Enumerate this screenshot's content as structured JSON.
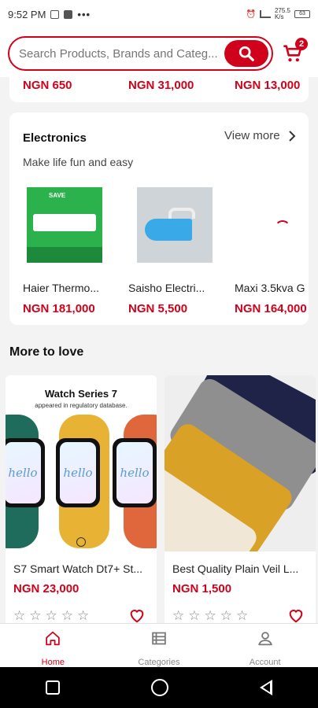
{
  "status_bar": {
    "time": "9:52 PM",
    "dots": "•••",
    "speed": "275.5\nK/s",
    "battery": "63"
  },
  "search": {
    "placeholder": "Search Products, Brands and Categ..."
  },
  "cart": {
    "count": "2"
  },
  "previous_row": {
    "prices": [
      "NGN 650",
      "NGN 31,000",
      "NGN 13,000"
    ]
  },
  "electronics": {
    "title": "Electronics",
    "subtitle": "Make life fun and easy",
    "view_more": "View more",
    "products": [
      {
        "name": "Haier Thermo...",
        "price": "NGN 181,000",
        "image_badge": "SAVE"
      },
      {
        "name": "Saisho Electri...",
        "price": "NGN 5,500"
      },
      {
        "name": "Maxi 3.5kva G",
        "price": "NGN 164,000"
      }
    ]
  },
  "more_to_love": {
    "title": "More to love",
    "items": [
      {
        "headline": "Watch Series 7",
        "note": "appeared in regulatory database.",
        "screen_text": "hello",
        "name": "S7 Smart Watch Dt7+ St...",
        "price": "NGN 23,000"
      },
      {
        "name": "Best Quality Plain Veil  L...",
        "price": "NGN 1,500"
      }
    ],
    "star_glyph": "☆"
  },
  "bottom_nav": {
    "items": [
      {
        "label": "Home",
        "active": true
      },
      {
        "label": "Categories",
        "active": false
      },
      {
        "label": "Account",
        "active": false
      }
    ]
  },
  "colors": {
    "accent": "#d0021b",
    "muted": "#888888"
  }
}
